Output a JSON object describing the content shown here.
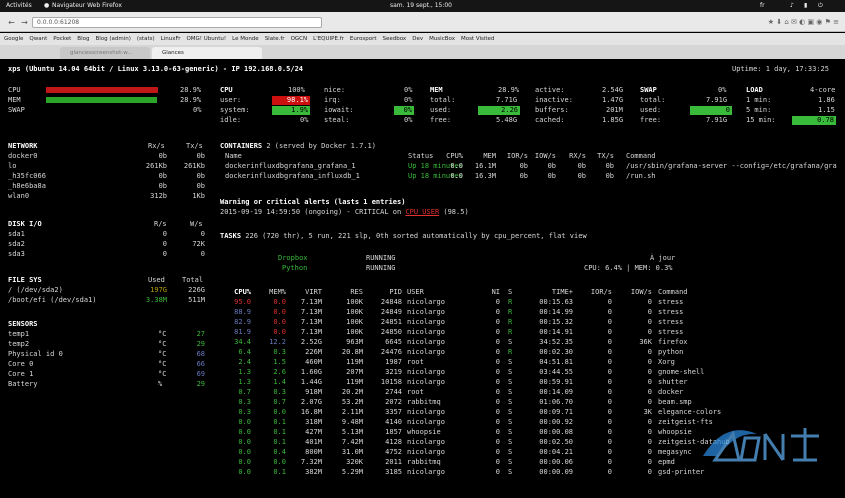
{
  "topbar": {
    "activities": "Activités",
    "app": "Navigateur Web Firefox",
    "clock": "sam. 19 sept., 15:00",
    "lang": "fr"
  },
  "browser": {
    "url": "0.0.0.0:61208",
    "tab_bg": "glancesscreenshot-w...",
    "tab_active": "Glances",
    "bookmarks": [
      "Google",
      "Qwant",
      "Pocket",
      "Blog",
      "Blog (admin)",
      "(stats)",
      "LinuxFr",
      "OMG! Ubuntu!",
      "Le Monde",
      "Slate.fr",
      "OGCN",
      "L'EQUIPE.fr",
      "Eurosport",
      "Seedbox",
      "Dev",
      "MusicBox",
      "Most Visited"
    ]
  },
  "header": {
    "left": "xps (Ubuntu 14.04 64bit / Linux 3.13.0-63-generic) - IP 192.168.0.5/24",
    "uptime": "Uptime: 1 day, 17:33:25"
  },
  "quicklook": [
    {
      "label": "CPU",
      "pct": "28.9%",
      "fill": 0.289
    },
    {
      "label": "MEM",
      "pct": "28.9%",
      "fill": 0.289
    },
    {
      "label": "SWAP",
      "pct": "0%",
      "fill": 0
    }
  ],
  "cpu": {
    "title": "CPU",
    "total": "100%",
    "rows": [
      [
        "user:",
        "98.1%",
        "nice:",
        "0%"
      ],
      [
        "system:",
        "1.9%",
        "irq:",
        "0%"
      ],
      [
        "idle:",
        "0%",
        "iowait:",
        "0%"
      ],
      [
        "",
        "",
        "steal:",
        "0%"
      ]
    ]
  },
  "mem": {
    "title": "MEM",
    "pct": "28.9%",
    "rows": [
      [
        "total:",
        "7.71G",
        "active:",
        "2.54G"
      ],
      [
        "used:",
        "2.26",
        "inactive:",
        "1.47G"
      ],
      [
        "free:",
        "5.48G",
        "buffers:",
        "201M"
      ],
      [
        "",
        "",
        "cached:",
        "1.85G"
      ]
    ]
  },
  "swap": {
    "title": "SWAP",
    "pct": "0%",
    "rows": [
      [
        "total:",
        "7.91G"
      ],
      [
        "used:",
        "0"
      ],
      [
        "free:",
        "7.91G"
      ]
    ]
  },
  "load": {
    "title": "LOAD",
    "cores": "4-core",
    "rows": [
      [
        "1 min:",
        "1.86"
      ],
      [
        "5 min:",
        "1.15"
      ],
      [
        "15 min:",
        "0.78"
      ]
    ]
  },
  "network": {
    "title": "NETWORK",
    "cols": [
      "Rx/s",
      "Tx/s"
    ],
    "rows": [
      [
        "docker0",
        "0b",
        "0b"
      ],
      [
        "lo",
        "261Kb",
        "261Kb"
      ],
      [
        "_h35fc066",
        "0b",
        "0b"
      ],
      [
        "_h8e6ba8a",
        "0b",
        "0b"
      ],
      [
        "wlan0",
        "312b",
        "1Kb"
      ]
    ]
  },
  "disk": {
    "title": "DISK I/O",
    "cols": [
      "R/s",
      "W/s"
    ],
    "rows": [
      [
        "sda1",
        "0",
        "0"
      ],
      [
        "sda2",
        "0",
        "72K"
      ],
      [
        "sda3",
        "0",
        "0"
      ]
    ]
  },
  "fs": {
    "title": "FILE SYS",
    "cols": [
      "Used",
      "Total"
    ],
    "rows": [
      [
        "/ (/dev/sda2)",
        "197G",
        "226G"
      ],
      [
        "/boot/efi (/dev/sda1)",
        "3.38M",
        "511M"
      ]
    ]
  },
  "sensors": {
    "title": "SENSORS",
    "rows": [
      [
        "temp1",
        "°C",
        "27"
      ],
      [
        "temp2",
        "°C",
        "29"
      ],
      [
        "Physical id 0",
        "°C",
        "68"
      ],
      [
        "Core 0",
        "°C",
        "66"
      ],
      [
        "Core 1",
        "°C",
        "69"
      ],
      [
        "Battery",
        "%",
        "29"
      ]
    ]
  },
  "containers": {
    "title": "CONTAINERS",
    "count": "2 (served by Docker 1.7.1)",
    "cols": [
      "Name",
      "Status",
      "CPU%",
      "MEM",
      "IOR/s",
      "IOW/s",
      "RX/s",
      "TX/s",
      "Command"
    ],
    "rows": [
      [
        "dockerinfluxdbgrafana_grafana_1",
        "Up 18 minutes",
        "0.0",
        "16.1M",
        "0b",
        "0b",
        "0b",
        "0b",
        "/usr/sbin/grafana-server --config=/etc/grafana/gra"
      ],
      [
        "dockerinfluxdbgrafana_influxdb_1",
        "Up 18 minutes",
        "0.0",
        "16.3M",
        "0b",
        "0b",
        "0b",
        "0b",
        "/run.sh"
      ]
    ]
  },
  "alerts": {
    "title": "Warning or critical alerts (lasts 1 entries)",
    "line_pre": "2015-09-19 14:59:50 (ongoing) - CRITICAL on",
    "line_tag": "CPU_USER",
    "line_post": "(98.5)"
  },
  "tasks": {
    "label": "TASKS",
    "text": "226 (720 thr), 5 run, 221 slp, 0th sorted automatically by cpu_percent, flat view"
  },
  "amps": [
    [
      "Dropbox",
      "RUNNING"
    ],
    [
      "Python",
      "RUNNING"
    ]
  ],
  "amps_right": [
    "À jour",
    "CPU: 6.4% | MEM: 0.3%"
  ],
  "proc_cols": [
    "CPU%",
    "MEM%",
    "VIRT",
    "RES",
    "PID",
    "USER",
    "NI",
    "S",
    "TIME+",
    "IOR/s",
    "IOW/s",
    "Command"
  ],
  "processes": [
    [
      "95.0",
      "0.0",
      "7.13M",
      "100K",
      "24848",
      "nicolargo",
      "0",
      "R",
      "00:15.63",
      "0",
      "0",
      "stress"
    ],
    [
      "88.9",
      "0.0",
      "7.13M",
      "100K",
      "24849",
      "nicolargo",
      "0",
      "R",
      "00:14.99",
      "0",
      "0",
      "stress"
    ],
    [
      "82.9",
      "0.0",
      "7.13M",
      "100K",
      "24851",
      "nicolargo",
      "0",
      "R",
      "00:15.32",
      "0",
      "0",
      "stress"
    ],
    [
      "81.9",
      "0.0",
      "7.13M",
      "100K",
      "24850",
      "nicolargo",
      "0",
      "R",
      "00:14.91",
      "0",
      "0",
      "stress"
    ],
    [
      "34.4",
      "12.2",
      "2.52G",
      "963M",
      "6645",
      "nicolargo",
      "0",
      "S",
      "34:52.35",
      "0",
      "36K",
      "firefox"
    ],
    [
      "6.4",
      "0.3",
      "226M",
      "20.8M",
      "24476",
      "nicolargo",
      "0",
      "R",
      "00:02.30",
      "0",
      "0",
      "python"
    ],
    [
      "2.4",
      "1.5",
      "460M",
      "119M",
      "1987",
      "root",
      "0",
      "S",
      "04:51.81",
      "0",
      "0",
      "Xorg"
    ],
    [
      "1.3",
      "2.6",
      "1.60G",
      "207M",
      "3219",
      "nicolargo",
      "0",
      "S",
      "03:44.55",
      "0",
      "0",
      "gnome-shell"
    ],
    [
      "1.3",
      "1.4",
      "1.44G",
      "119M",
      "10158",
      "nicolargo",
      "0",
      "S",
      "00:59.91",
      "0",
      "0",
      "shutter"
    ],
    [
      "0.7",
      "0.3",
      "918M",
      "20.2M",
      "2744",
      "root",
      "0",
      "S",
      "00:14.09",
      "0",
      "0",
      "docker"
    ],
    [
      "0.3",
      "0.7",
      "2.07G",
      "53.2M",
      "2072",
      "rabbitmq",
      "0",
      "S",
      "01:06.70",
      "0",
      "0",
      "beam.smp"
    ],
    [
      "0.3",
      "0.0",
      "16.8M",
      "2.11M",
      "3357",
      "nicolargo",
      "0",
      "S",
      "00:09.71",
      "0",
      "3K",
      "elegance-colors"
    ],
    [
      "0.0",
      "0.1",
      "318M",
      "9.48M",
      "4140",
      "nicolargo",
      "0",
      "S",
      "00:00.92",
      "0",
      "0",
      "zeitgeist-fts"
    ],
    [
      "0.0",
      "0.1",
      "427M",
      "5.13M",
      "1857",
      "whoopsie",
      "0",
      "S",
      "00:00.08",
      "0",
      "0",
      "whoopsie"
    ],
    [
      "0.0",
      "0.1",
      "401M",
      "7.42M",
      "4128",
      "nicolargo",
      "0",
      "S",
      "00:02.50",
      "0",
      "0",
      "zeitgeist-datahub"
    ],
    [
      "0.0",
      "0.4",
      "800M",
      "31.0M",
      "4752",
      "nicolargo",
      "0",
      "S",
      "00:04.21",
      "0",
      "0",
      "megasync"
    ],
    [
      "0.0",
      "0.0",
      "7.32M",
      "320K",
      "2011",
      "rabbitmq",
      "0",
      "S",
      "00:00.06",
      "0",
      "0",
      "epmd"
    ],
    [
      "0.0",
      "0.1",
      "382M",
      "5.29M",
      "3185",
      "nicolargo",
      "0",
      "S",
      "00:00.09",
      "0",
      "0",
      "gsd-printer"
    ]
  ],
  "colors": {
    "critical": "#cc1010",
    "ok": "#2aa52a",
    "careful": "#4a5ab0",
    "bg": "#000000"
  }
}
